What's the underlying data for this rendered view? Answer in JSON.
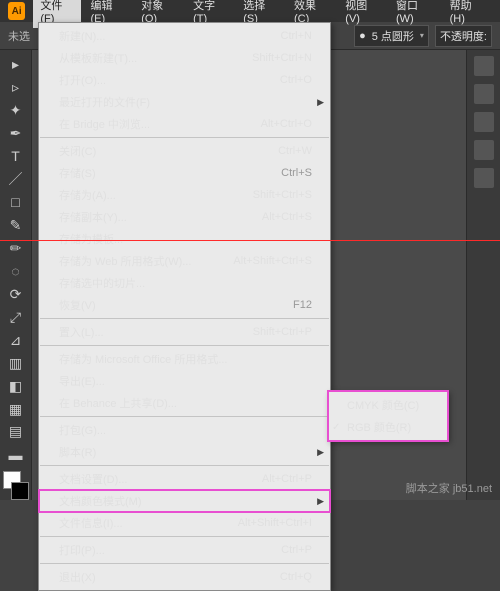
{
  "app": {
    "logo": "Ai"
  },
  "menu": {
    "items": [
      "文件(F)",
      "编辑(E)",
      "对象(O)",
      "文字(T)",
      "选择(S)",
      "效果(C)",
      "视图(V)",
      "窗口(W)",
      "帮助(H)"
    ]
  },
  "control": {
    "nosel": "未选",
    "stroke_field": "5 点圆形",
    "opacity_label": "不透明度:"
  },
  "file_menu": [
    {
      "t": "item",
      "label": "新建(N)...",
      "sc": "Ctrl+N"
    },
    {
      "t": "item",
      "label": "从模板新建(T)...",
      "sc": "Shift+Ctrl+N"
    },
    {
      "t": "item",
      "label": "打开(O)...",
      "sc": "Ctrl+O"
    },
    {
      "t": "sub",
      "label": "最近打开的文件(F)"
    },
    {
      "t": "item",
      "label": "在 Bridge 中浏览...",
      "sc": "Alt+Ctrl+O"
    },
    {
      "t": "sep"
    },
    {
      "t": "item",
      "label": "关闭(C)",
      "sc": "Ctrl+W"
    },
    {
      "t": "item",
      "label": "存储(S)",
      "sc": "Ctrl+S",
      "dis": true
    },
    {
      "t": "item",
      "label": "存储为(A)...",
      "sc": "Shift+Ctrl+S"
    },
    {
      "t": "item",
      "label": "存储副本(Y)...",
      "sc": "Alt+Ctrl+S"
    },
    {
      "t": "item",
      "label": "存储为模板..."
    },
    {
      "t": "item",
      "label": "存储为 Web 所用格式(W)...",
      "sc": "Alt+Shift+Ctrl+S"
    },
    {
      "t": "item",
      "label": "存储选中的切片..."
    },
    {
      "t": "item",
      "label": "恢复(V)",
      "sc": "F12",
      "dis": true
    },
    {
      "t": "sep"
    },
    {
      "t": "item",
      "label": "置入(L)...",
      "sc": "Shift+Ctrl+P"
    },
    {
      "t": "sep"
    },
    {
      "t": "item",
      "label": "存储为 Microsoft Office 所用格式..."
    },
    {
      "t": "item",
      "label": "导出(E)..."
    },
    {
      "t": "item",
      "label": "在 Behance 上共享(D)..."
    },
    {
      "t": "sep"
    },
    {
      "t": "item",
      "label": "打包(G)..."
    },
    {
      "t": "sub",
      "label": "脚本(R)"
    },
    {
      "t": "sep"
    },
    {
      "t": "item",
      "label": "文档设置(D)...",
      "sc": "Alt+Ctrl+P"
    },
    {
      "t": "sub",
      "label": "文档颜色模式(M)",
      "hl": true
    },
    {
      "t": "item",
      "label": "文件信息(I)...",
      "sc": "Alt+Shift+Ctrl+I"
    },
    {
      "t": "sep"
    },
    {
      "t": "item",
      "label": "打印(P)...",
      "sc": "Ctrl+P"
    },
    {
      "t": "sep"
    },
    {
      "t": "item",
      "label": "退出(X)",
      "sc": "Ctrl+Q"
    }
  ],
  "color_mode_submenu": [
    {
      "label": "CMYK 颜色(C)",
      "checked": false
    },
    {
      "label": "RGB 颜色(R)",
      "checked": true
    }
  ],
  "watermark": "脚本之家 jb51.net"
}
